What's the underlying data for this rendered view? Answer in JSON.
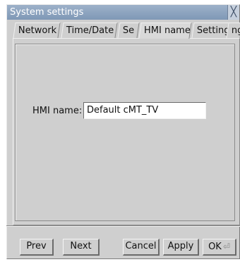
{
  "window": {
    "title": "System settings"
  },
  "tabs": [
    {
      "label": "Network"
    },
    {
      "label": "Time/Date"
    },
    {
      "label": "Se"
    },
    {
      "label": "HMI name"
    },
    {
      "label": "Setting"
    },
    {
      "label": "ng"
    }
  ],
  "active_tab": "HMI name",
  "form": {
    "hmi_name_label": "HMI name:",
    "hmi_name_value": "Default cMT_TV"
  },
  "buttons": {
    "prev": "Prev",
    "next": "Next",
    "cancel": "Cancel",
    "apply": "Apply",
    "ok": "OK"
  },
  "icons": {
    "close": "close-icon",
    "ok": "enter-icon"
  }
}
